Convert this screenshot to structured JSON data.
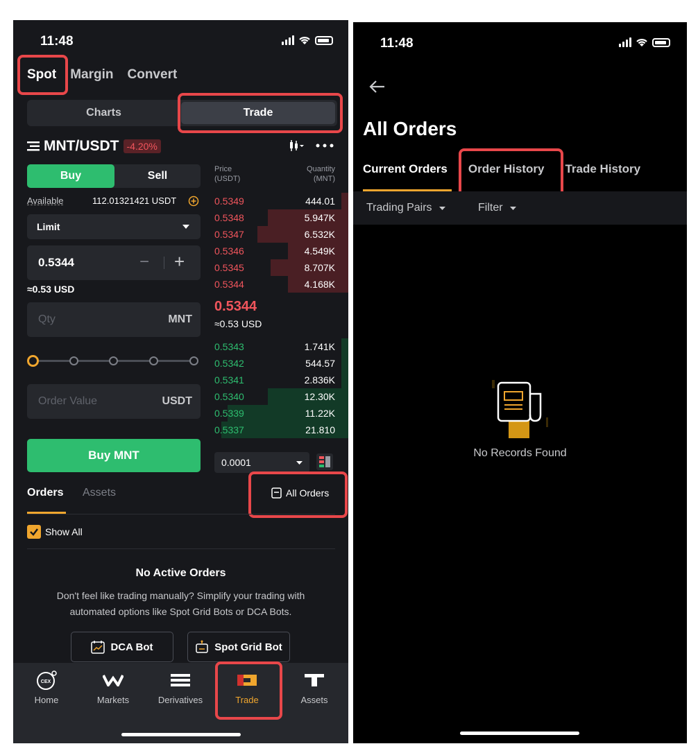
{
  "left": {
    "status_time": "11:48",
    "top_tabs": [
      "Spot",
      "Margin",
      "Convert"
    ],
    "seg": {
      "charts": "Charts",
      "trade": "Trade"
    },
    "pair": "MNT/USDT",
    "change": "-4.20%",
    "buy": "Buy",
    "sell": "Sell",
    "available_label": "Available",
    "available_value": "112.01321421 USDT",
    "order_type": "Limit",
    "price_value": "0.5344",
    "price_usd": "≈0.53 USD",
    "qty_placeholder": "Qty",
    "qty_unit": "MNT",
    "value_placeholder": "Order Value",
    "value_unit": "USDT",
    "buy_button": "Buy MNT",
    "ob_header": {
      "price": "Price",
      "price_unit": "(USDT)",
      "qty": "Quantity",
      "qty_unit": "(MNT)"
    },
    "asks": [
      {
        "p": "0.5349",
        "q": "444.01",
        "depth": 0.05
      },
      {
        "p": "0.5348",
        "q": "5.947K",
        "depth": 0.6
      },
      {
        "p": "0.5347",
        "q": "6.532K",
        "depth": 0.68
      },
      {
        "p": "0.5346",
        "q": "4.549K",
        "depth": 0.45
      },
      {
        "p": "0.5345",
        "q": "8.707K",
        "depth": 0.58
      },
      {
        "p": "0.5344",
        "q": "4.168K",
        "depth": 0.45
      }
    ],
    "mid_price": "0.5344",
    "mid_usd": "≈0.53 USD",
    "bids": [
      {
        "p": "0.5343",
        "q": "1.741K",
        "depth": 0.05
      },
      {
        "p": "0.5342",
        "q": "544.57",
        "depth": 0.05
      },
      {
        "p": "0.5341",
        "q": "2.836K",
        "depth": 0.05
      },
      {
        "p": "0.5340",
        "q": "12.30K",
        "depth": 0.6
      },
      {
        "p": "0.5339",
        "q": "11.22K",
        "depth": 0.9
      },
      {
        "p": "0.5337",
        "q": "21.810",
        "depth": 0.95
      }
    ],
    "precision": "0.0001",
    "orders_tab": "Orders",
    "assets_tab": "Assets",
    "all_orders": "All Orders",
    "show_all": "Show All",
    "empty_title": "No Active Orders",
    "empty_desc1": "Don't feel like trading manually? Simplify your trading with",
    "empty_desc2": "automated options like Spot Grid Bots or DCA Bots.",
    "dca_bot": "DCA Bot",
    "grid_bot": "Spot Grid Bot",
    "tabs": [
      "Home",
      "Markets",
      "Derivatives",
      "Trade",
      "Assets"
    ],
    "cex": "CEX"
  },
  "right": {
    "status_time": "11:48",
    "title": "All Orders",
    "tabs": [
      "Current Orders",
      "Order History",
      "Trade History"
    ],
    "filter_pairs": "Trading Pairs",
    "filter": "Filter",
    "empty": "No Records Found"
  },
  "colors": {
    "red": "#f0555c",
    "green": "#2ebd6f",
    "accent": "#f0a62e",
    "highlight": "#e8474a"
  }
}
